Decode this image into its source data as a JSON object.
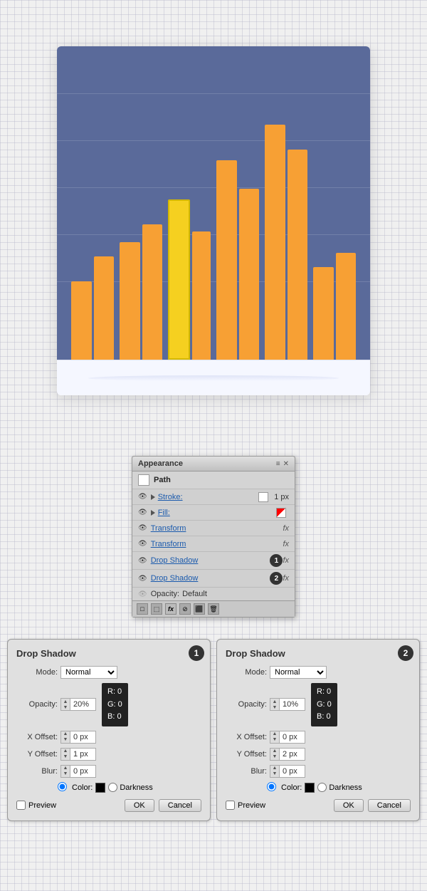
{
  "canvas": {
    "chart": {
      "bars": [
        {
          "heights": [
            140,
            200
          ]
        },
        {
          "heights": [
            230,
            280
          ]
        },
        {
          "heights": [
            300,
            250
          ]
        },
        {
          "heights": [
            360,
            310
          ]
        },
        {
          "heights": [
            420,
            380
          ]
        },
        {
          "heights": [
            170,
            190
          ]
        }
      ]
    }
  },
  "appearance_panel": {
    "title": "Appearance",
    "path_label": "Path",
    "stroke_label": "Stroke:",
    "stroke_value": "1 px",
    "fill_label": "Fill:",
    "transform_label1": "Transform",
    "transform_label2": "Transform",
    "drop_shadow_label1": "Drop Shadow",
    "drop_shadow_label2": "Drop Shadow",
    "opacity_label": "Opacity:",
    "opacity_value": "Default",
    "fx_symbol": "fx",
    "badge1": "1",
    "badge2": "2"
  },
  "drop_shadow_1": {
    "title": "Drop Shadow",
    "badge": "1",
    "mode_label": "Mode:",
    "mode_value": "Normal",
    "opacity_label": "Opacity:",
    "opacity_value": "20%",
    "x_offset_label": "X Offset:",
    "x_offset_value": "0 px",
    "y_offset_label": "Y Offset:",
    "y_offset_value": "1 px",
    "blur_label": "Blur:",
    "blur_value": "0 px",
    "color_label": "Color:",
    "darkness_label": "Darkness",
    "rgb": {
      "r": "R: 0",
      "g": "G: 0",
      "b": "B: 0"
    },
    "preview_label": "Preview",
    "ok_label": "OK",
    "cancel_label": "Cancel"
  },
  "drop_shadow_2": {
    "title": "Drop Shadow",
    "badge": "2",
    "mode_label": "Mode:",
    "mode_value": "Normal",
    "opacity_label": "Opacity:",
    "opacity_value": "10%",
    "x_offset_label": "X Offset:",
    "x_offset_value": "0 px",
    "y_offset_label": "Y Offset:",
    "y_offset_value": "2 px",
    "blur_label": "Blur:",
    "blur_value": "0 px",
    "color_label": "Color:",
    "darkness_label": "Darkness",
    "rgb": {
      "r": "R: 0",
      "g": "G: 0",
      "b": "B: 0"
    },
    "preview_label": "Preview",
    "ok_label": "OK",
    "cancel_label": "Cancel"
  }
}
